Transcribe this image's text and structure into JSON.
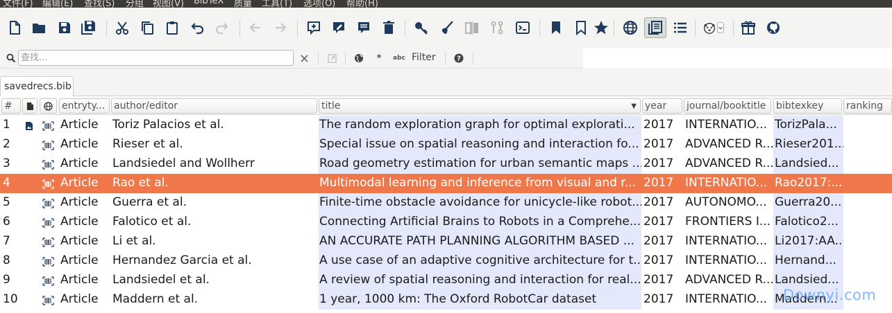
{
  "menu": [
    "文件(F)",
    "编辑(E)",
    "查找(S)",
    "分组",
    "视图(V)",
    "BibTeX",
    "质量",
    "工具(T)",
    "选项(O)",
    "帮助(H)"
  ],
  "toolbar": {
    "icons": [
      "new-file-icon",
      "open-folder-icon",
      "save-icon",
      "save-all-icon",
      "cut-icon",
      "copy-icon",
      "paste-icon",
      "undo-icon",
      "redo-icon",
      "back-arrow-icon",
      "forward-arrow-icon",
      "new-entry-icon",
      "edit-entry-icon",
      "edit-strings-icon",
      "delete-icon",
      "key-icon",
      "cleanup-icon",
      "merge-icon",
      "sync-icon",
      "terminal-icon",
      "bookmark-filled-icon",
      "bookmark-outline-icon",
      "star-icon",
      "globe-icon",
      "preview-icon",
      "list-icon",
      "dog-face-icon",
      "gift-icon",
      "github-icon"
    ]
  },
  "search": {
    "placeholder": "查找...",
    "filter_label": "Filter",
    "regex_label": "*",
    "case_label": "abc"
  },
  "tab": {
    "label": "savedrecs.bib"
  },
  "columns": {
    "number": "#",
    "entrytype": "entryty...",
    "author": "author/editor",
    "title": "title",
    "year": "year",
    "journal": "journal/booktitle",
    "bibtexkey": "bibtexkey",
    "ranking": "ranking"
  },
  "colors": {
    "selected_row": "#f0774a",
    "highlight_column": "#e4e8fb",
    "menubar": "#3c3b37"
  },
  "rows": [
    {
      "n": "1",
      "type": "Article",
      "author": "Toriz Palacios et al.",
      "title": "The random exploration graph for optimal explorati...",
      "year": "2017",
      "journal": "INTERNATIO...",
      "key": "TorizPala...",
      "pdf": true
    },
    {
      "n": "2",
      "type": "Article",
      "author": "Rieser et al.",
      "title": "Special issue on spatial reasoning and interaction fo...",
      "year": "2017",
      "journal": "ADVANCED R...",
      "key": "Rieser201...",
      "pdf": false
    },
    {
      "n": "3",
      "type": "Article",
      "author": "Landsiedel and Wollherr",
      "title": "Road geometry estimation for urban semantic maps ...",
      "year": "2017",
      "journal": "ADVANCED R...",
      "key": "Landsied...",
      "pdf": false
    },
    {
      "n": "4",
      "type": "Article",
      "author": "Rao et al.",
      "title": "Multimodal learning and inference from visual and r...",
      "year": "2017",
      "journal": "INTERNATIO...",
      "key": "Rao2017:...",
      "pdf": false,
      "selected": true
    },
    {
      "n": "5",
      "type": "Article",
      "author": "Guerra et al.",
      "title": "Finite-time obstacle avoidance for unicycle-like robot...",
      "year": "2017",
      "journal": "AUTONOMO...",
      "key": "Guerra20...",
      "pdf": false
    },
    {
      "n": "6",
      "type": "Article",
      "author": "Falotico et al.",
      "title": "Connecting Artificial Brains to Robots in a Comprehe...",
      "year": "2017",
      "journal": "FRONTIERS I...",
      "key": "Falotico2...",
      "pdf": false
    },
    {
      "n": "7",
      "type": "Article",
      "author": "Li et al.",
      "title": "AN ACCURATE PATH PLANNING ALGORITHM BASED ...",
      "year": "2017",
      "journal": "INTERNATIO...",
      "key": "Li2017:AA...",
      "pdf": false
    },
    {
      "n": "8",
      "type": "Article",
      "author": "Hernandez Garcia et al.",
      "title": "A use case of an adaptive cognitive architecture for t...",
      "year": "2017",
      "journal": "INTERNATIO...",
      "key": "Hernand...",
      "pdf": false
    },
    {
      "n": "9",
      "type": "Article",
      "author": "Landsiedel et al.",
      "title": "A review of spatial reasoning and interaction for real...",
      "year": "2017",
      "journal": "ADVANCED R...",
      "key": "Landsied...",
      "pdf": false
    },
    {
      "n": "10",
      "type": "Article",
      "author": "Maddern et al.",
      "title": "1 year, 1000 km: The Oxford RobotCar dataset",
      "year": "2017",
      "journal": "INTERNATIO...",
      "key": "Maddern...",
      "pdf": false
    }
  ],
  "watermark": "Downyi.com"
}
